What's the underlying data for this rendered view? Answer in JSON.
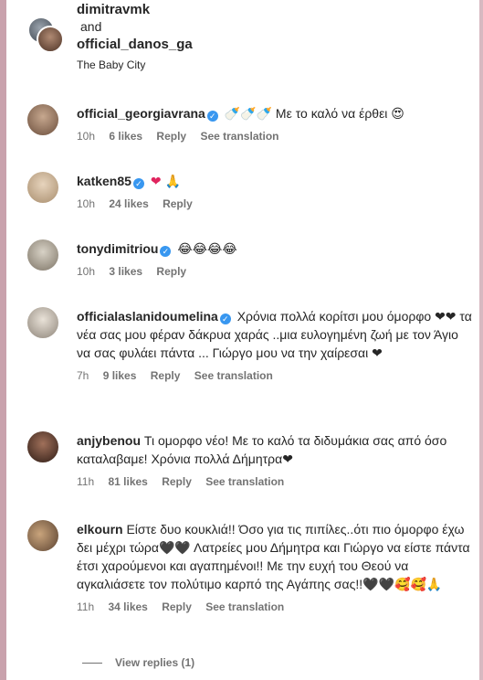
{
  "header": {
    "user1": "dimitravmk",
    "and_text": "and",
    "user2": "official_danos_ga",
    "subtitle": "The Baby City"
  },
  "comments": [
    {
      "username": "official_georgiavrana",
      "text": "🍼🍼🍼 Με το καλό να έρθει 😍",
      "time": "10h",
      "likes": "6 likes",
      "reply": "Reply",
      "see_translation": "See translation"
    },
    {
      "username": "katken85",
      "text": "❤ 🙏",
      "time": "10h",
      "likes": "24 likes",
      "reply": "Reply"
    },
    {
      "username": "tonydimitriou",
      "text": "😂😂😂😂",
      "time": "10h",
      "likes": "3 likes",
      "reply": "Reply"
    },
    {
      "username": "officialaslanidoumelina",
      "text": "Χρόνια πολλά κορίτσι μου όμορφο ❤❤ τα νέα σας μου φέραν δάκρυα χαράς ..μια ευλογημένη ζωή με τον Άγιο να σας φυλάει πάντα ... Γιώργο μου να την χαίρεσαι ❤",
      "time": "7h",
      "likes": "9 likes",
      "reply": "Reply",
      "see_translation": "See translation"
    },
    {
      "username": "anjybenou",
      "text": "Τι ομορφο νέο! Με το καλό τα διδυμάκια σας από όσο καταλαβαμε! Χρόνια πολλά Δήμητρα❤",
      "time": "11h",
      "likes": "81 likes",
      "reply": "Reply",
      "see_translation": "See translation"
    },
    {
      "username": "elkourn",
      "text": "Είστε δυο κουκλιά!! Όσο για τις πιπίλες..ότι πιο όμορφο έχω δει μέχρι τώρα🖤🖤 Λατρείες μου Δήμητρα και Γιώργο να είστε πάντα έτσι χαρούμενοι και αγαπημένοι!! Με την ευχή του Θεού να αγκαλιάσετε τον πολύτιμο καρπό της Αγάπης σας!!🖤🖤🥰🥰🙏",
      "time": "11h",
      "likes": "34 likes",
      "reply": "Reply",
      "see_translation": "See translation"
    }
  ],
  "view_replies": "View replies (1)",
  "verified_icon": "✓"
}
